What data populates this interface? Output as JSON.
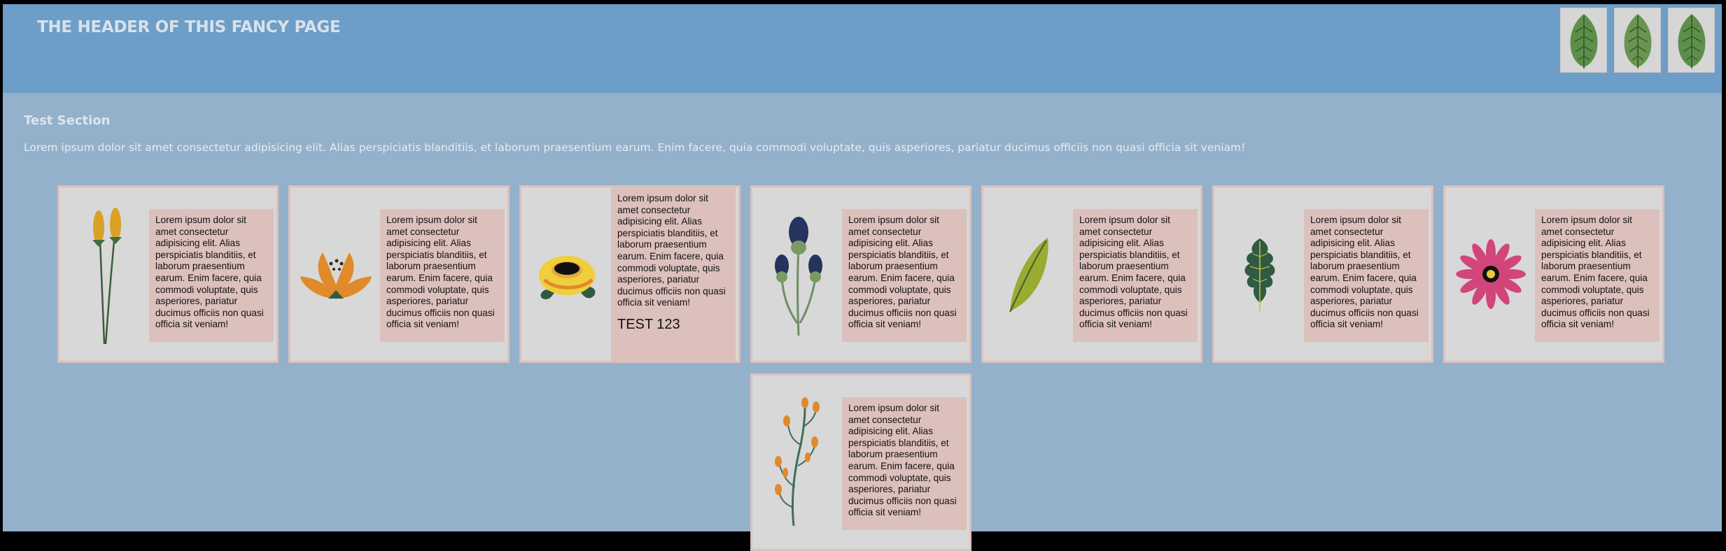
{
  "header": {
    "title": "THE HEADER OF THIS FANCY PAGE",
    "icons": [
      "leaf-icon",
      "leaf-icon",
      "leaf-icon"
    ]
  },
  "section": {
    "title": "Test Section",
    "description": "Lorem ipsum dolor sit amet consectetur adipisicing elit. Alias perspiciatis blanditiis, et laborum praesentium earum. Enim facere, quia commodi voluptate, quis asperiores, pariatur ducimus officiis non quasi officia sit veniam!"
  },
  "cards": [
    {
      "icon": "yellow-buds-icon",
      "text": "Lorem ipsum dolor sit amet consectetur adipisicing elit. Alias perspiciatis blanditiis, et laborum praesentium earum. Enim facere, quia commodi voluptate, quis asperiores, pariatur ducimus officiis non quasi officia sit veniam!"
    },
    {
      "icon": "orange-flower-icon",
      "text": "Lorem ipsum dolor sit amet consectetur adipisicing elit. Alias perspiciatis blanditiis, et laborum praesentium earum. Enim facere, quia commodi voluptate, quis asperiores, pariatur ducimus officiis non quasi officia sit veniam!"
    },
    {
      "icon": "yellow-rose-icon",
      "text": "Lorem ipsum dolor sit amet consectetur adipisicing elit. Alias perspiciatis blanditiis, et laborum praesentium earum. Enim facere, quia commodi voluptate, quis asperiores, pariatur ducimus officiis non quasi officia sit veniam!",
      "extra": "TEST 123"
    },
    {
      "icon": "thistle-icon",
      "text": "Lorem ipsum dolor sit amet consectetur adipisicing elit. Alias perspiciatis blanditiis, et laborum praesentium earum. Enim facere, quia commodi voluptate, quis asperiores, pariatur ducimus officiis non quasi officia sit veniam!"
    },
    {
      "icon": "green-leaf-icon",
      "text": "Lorem ipsum dolor sit amet consectetur adipisicing elit. Alias perspiciatis blanditiis, et laborum praesentium earum. Enim facere, quia commodi voluptate, quis asperiores, pariatur ducimus officiis non quasi officia sit veniam!"
    },
    {
      "icon": "oak-leaf-icon",
      "text": "Lorem ipsum dolor sit amet consectetur adipisicing elit. Alias perspiciatis blanditiis, et laborum praesentium earum. Enim facere, quia commodi voluptate, quis asperiores, pariatur ducimus officiis non quasi officia sit veniam!"
    },
    {
      "icon": "pink-daisy-icon",
      "text": "Lorem ipsum dolor sit amet consectetur adipisicing elit. Alias perspiciatis blanditiis, et laborum praesentium earum. Enim facere, quia commodi voluptate, quis asperiores, pariatur ducimus officiis non quasi officia sit veniam!"
    },
    {
      "icon": "orange-berry-branch-icon",
      "text": "Lorem ipsum dolor sit amet consectetur adipisicing elit. Alias perspiciatis blanditiis, et laborum praesentium earum. Enim facere, quia commodi voluptate, quis asperiores, pariatur ducimus officiis non quasi officia sit veniam!"
    }
  ],
  "colors": {
    "page_background": "#94b1cb",
    "header_background": "#6c9ec8",
    "card_background": "#d8d8d8",
    "card_text_background": "#dcc0bc"
  }
}
